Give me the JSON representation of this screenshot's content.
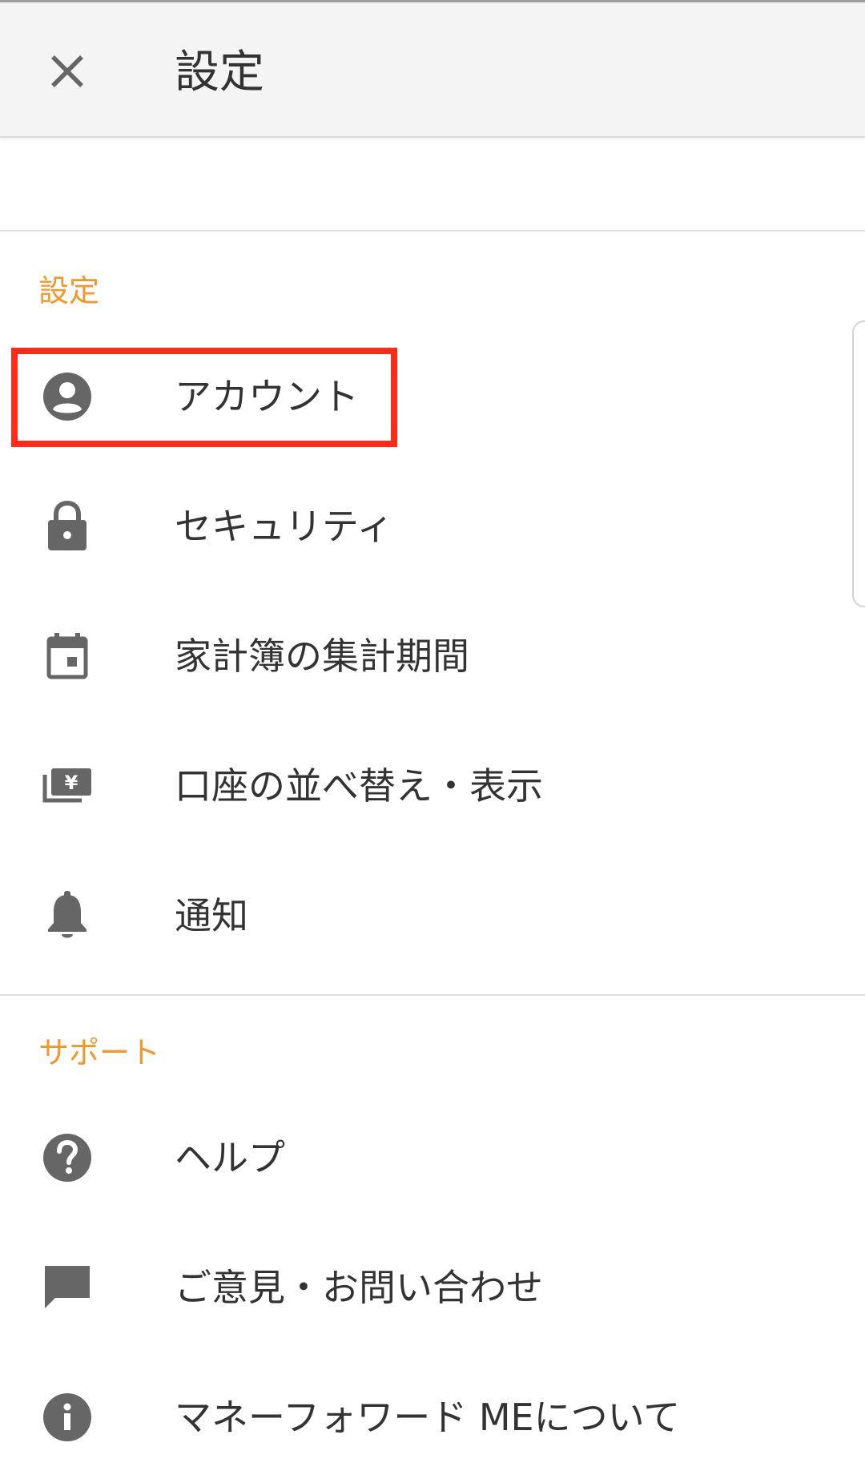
{
  "app_bar": {
    "title": "設定",
    "close_icon": "close-icon"
  },
  "sections": [
    {
      "header": "設定",
      "items": [
        {
          "label": "アカウント",
          "icon": "account-circle-icon"
        },
        {
          "label": "セキュリティ",
          "icon": "lock-icon"
        },
        {
          "label": "家計簿の集計期間",
          "icon": "calendar-icon"
        },
        {
          "label": "口座の並べ替え・表示",
          "icon": "wallet-yen-icon"
        },
        {
          "label": "通知",
          "icon": "bell-icon"
        }
      ]
    },
    {
      "header": "サポート",
      "items": [
        {
          "label": "ヘルプ",
          "icon": "help-circle-icon"
        },
        {
          "label": "ご意見・お問い合わせ",
          "icon": "chat-bubble-icon"
        },
        {
          "label": "マネーフォワード MEについて",
          "icon": "info-circle-icon"
        }
      ]
    }
  ],
  "colors": {
    "accent": "#f0982a",
    "highlight": "#ff2a17",
    "icon": "#666666",
    "text": "#333333",
    "app_bar_bg": "#f4f4f4"
  }
}
